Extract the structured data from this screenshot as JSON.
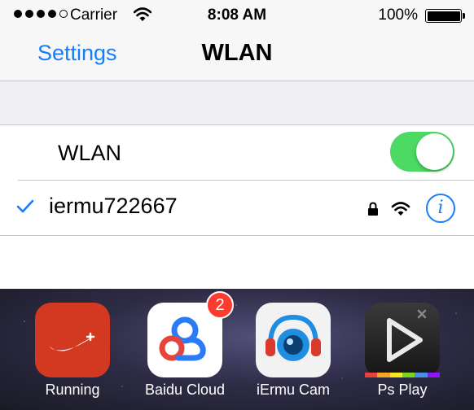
{
  "status_bar": {
    "carrier": "Carrier",
    "time": "8:08 AM",
    "battery_percent": "100%",
    "battery_level": 1.0,
    "signal_bars": 4,
    "signal_total": 5
  },
  "nav": {
    "back_label": "Settings",
    "title": "WLAN"
  },
  "wlan_row": {
    "label": "WLAN",
    "enabled": true
  },
  "network": {
    "name": "iermu722667",
    "selected": true,
    "secured": true,
    "info_glyph": "i"
  },
  "dock": {
    "apps": [
      {
        "label": "Running",
        "icon": "nike-running-icon"
      },
      {
        "label": "Baidu Cloud",
        "icon": "baidu-cloud-icon",
        "badge": "2"
      },
      {
        "label": "iErmu Cam",
        "icon": "iermu-cam-icon"
      },
      {
        "label": "Ps Play",
        "icon": "ps-play-icon"
      }
    ]
  },
  "colors": {
    "accent": "#157efb",
    "toggle_on": "#4cd964",
    "badge": "#ff3b30",
    "nav_bg": "#f7f7f7",
    "group_bg": "#efeff4"
  }
}
